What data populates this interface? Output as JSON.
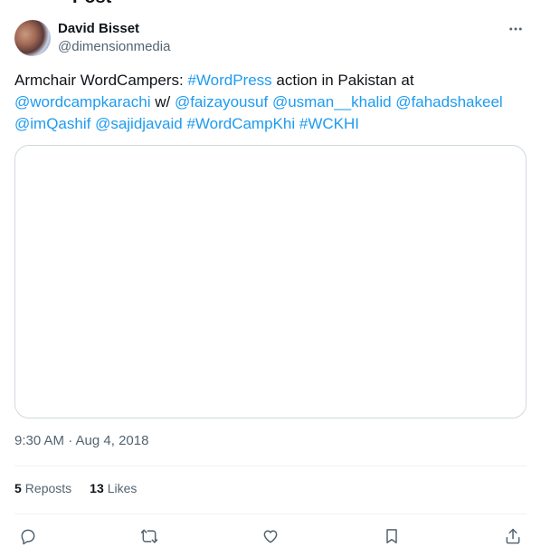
{
  "header_partial": "Post",
  "author": {
    "name": "David Bisset",
    "handle": "@dimensionmedia"
  },
  "tweet": {
    "segments": [
      {
        "text": "Armchair WordCampers: ",
        "link": false
      },
      {
        "text": "#WordPress",
        "link": true
      },
      {
        "text": " action in Pakistan at ",
        "link": false
      },
      {
        "text": "@wordcampkarachi",
        "link": true
      },
      {
        "text": " w/ ",
        "link": false
      },
      {
        "text": "@faizayousuf",
        "link": true
      },
      {
        "text": " ",
        "link": false
      },
      {
        "text": "@usman__khalid",
        "link": true
      },
      {
        "text": " ",
        "link": false
      },
      {
        "text": "@fahadshakeel",
        "link": true
      },
      {
        "text": " ",
        "link": false
      },
      {
        "text": "@imQashif",
        "link": true
      },
      {
        "text": " ",
        "link": false
      },
      {
        "text": "@sajidjavaid",
        "link": true
      },
      {
        "text": " ",
        "link": false
      },
      {
        "text": "#WordCampKhi",
        "link": true
      },
      {
        "text": " ",
        "link": false
      },
      {
        "text": "#WCKHI",
        "link": true
      }
    ]
  },
  "timestamp": "9:30 AM · Aug 4, 2018",
  "stats": {
    "reposts_count": "5",
    "reposts_label": "Reposts",
    "likes_count": "13",
    "likes_label": "Likes"
  },
  "icons": {
    "more": "more-horizontal-icon",
    "reply": "reply-icon",
    "repost": "repost-icon",
    "like": "heart-icon",
    "bookmark": "bookmark-icon",
    "share": "share-icon"
  },
  "colors": {
    "link": "#1d9bf0",
    "text": "#0f1419",
    "secondary": "#536471",
    "border": "#cfd9de"
  }
}
